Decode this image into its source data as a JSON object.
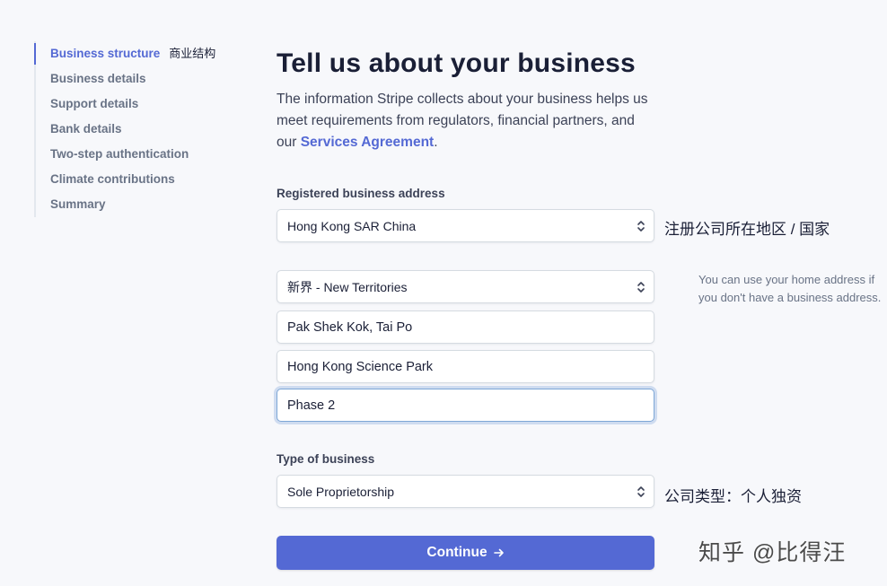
{
  "sidebar": {
    "items": [
      {
        "label": "Business structure",
        "active": true,
        "note": "商业结构"
      },
      {
        "label": "Business details"
      },
      {
        "label": "Support details"
      },
      {
        "label": "Bank details"
      },
      {
        "label": "Two-step authentication"
      },
      {
        "label": "Climate contributions"
      },
      {
        "label": "Summary"
      }
    ]
  },
  "main": {
    "title": "Tell us about your business",
    "intro_text": "The information Stripe collects about your business helps us meet requirements from regulators, financial partners, and our ",
    "intro_link": "Services Agreement",
    "intro_end": ".",
    "address_label": "Registered business address",
    "country_value": "Hong Kong SAR China",
    "country_annotation": "注册公司所在地区 / 国家",
    "region_value": "新界 - New Territories",
    "address_line1": "Pak Shek Kok, Tai Po",
    "address_line2": "Hong Kong Science Park",
    "address_line3": "Phase 2",
    "address_hint": "You can use your home address if you don't have a business address.",
    "type_label": "Type of business",
    "type_value": "Sole Proprietorship",
    "type_annotation": "公司类型：个人独资",
    "continue_label": "Continue"
  },
  "watermark": "知乎 @比得汪",
  "colors": {
    "accent": "#5469d4",
    "background": "#f7f8fb",
    "text": "#1a1f36"
  }
}
